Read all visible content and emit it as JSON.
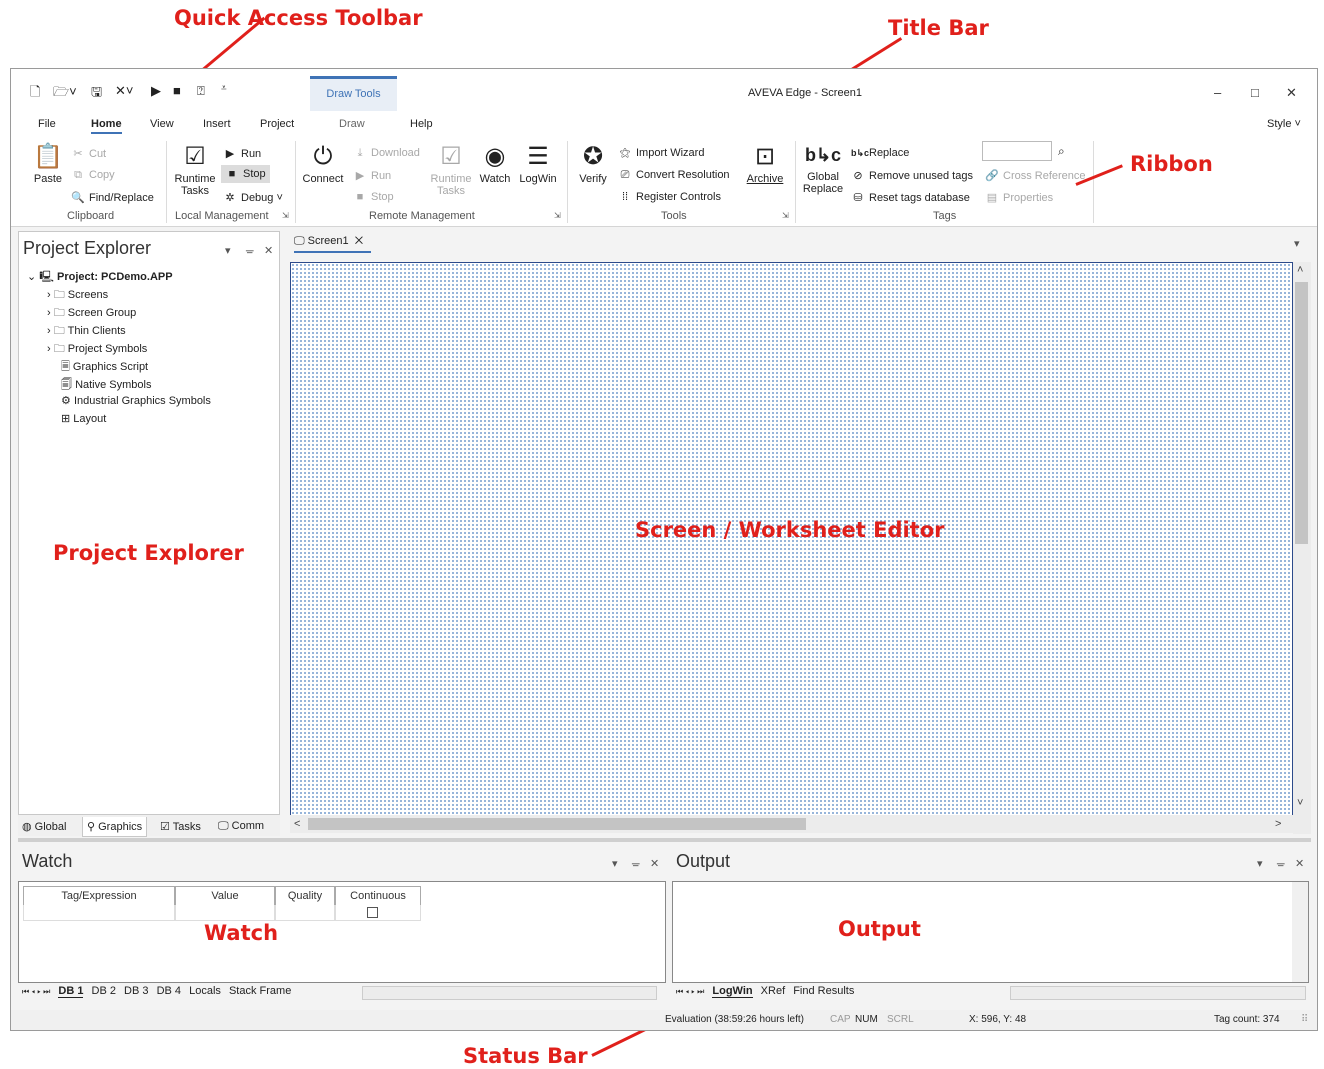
{
  "annotations": {
    "quick_access": "Quick Access Toolbar",
    "title_bar": "Title Bar",
    "ribbon": "Ribbon",
    "project_explorer": "Project Explorer",
    "editor": "Screen / Worksheet Editor",
    "watch": "Watch",
    "output": "Output",
    "status_bar": "Status Bar"
  },
  "titlebar": {
    "draw_tools": "Draw Tools",
    "title": "AVEVA Edge - Screen1",
    "min": "–",
    "max": "□",
    "close": "✕"
  },
  "quick_access": {
    "new": "🗋",
    "open": "🗁˅",
    "save": "🖫",
    "close": "✕˅",
    "run": "▶",
    "stop": "■",
    "help": "⍰",
    "more": "⩡"
  },
  "tabs": [
    "File",
    "Home",
    "View",
    "Insert",
    "Project",
    "Draw",
    "Help"
  ],
  "style_label": "Style",
  "style_chevron": "˅",
  "ribbon": {
    "paste": "Paste",
    "cut": "Cut",
    "copy": "Copy",
    "find_replace": "Find/Replace",
    "runtime_tasks": "Runtime Tasks",
    "run": "Run",
    "stop": "Stop",
    "debug": "Debug",
    "connect": "Connect",
    "download": "Download",
    "remote_run": "Run",
    "remote_stop": "Stop",
    "remote_runtime_tasks": "Runtime Tasks",
    "watch": "Watch",
    "logwin": "LogWin",
    "verify": "Verify",
    "import_wizard": "Import Wizard",
    "convert_resolution": "Convert Resolution",
    "register_controls": "Register Controls",
    "archive": "Archive",
    "global_replace": "Global Replace",
    "replace": "Replace",
    "remove_unused_tags": "Remove unused tags",
    "reset_tags_database": "Reset tags database",
    "cross_reference": "Cross Reference",
    "properties": "Properties",
    "groups": {
      "clipboard": "Clipboard",
      "local_management": "Local Management",
      "remote_management": "Remote Management",
      "tools": "Tools",
      "tags": "Tags"
    }
  },
  "project_explorer": {
    "title": "Project Explorer",
    "project": "Project: PCDemo.APP",
    "items": [
      "Screens",
      "Screen Group",
      "Thin Clients",
      "Project Symbols",
      "Graphics Script",
      "Native Symbols",
      "Industrial Graphics Symbols",
      "Layout"
    ],
    "tabs": [
      "Global",
      "Graphics",
      "Tasks",
      "Comm"
    ]
  },
  "panel_controls": {
    "dropdown": "▾",
    "pin": "ᚚ",
    "close": "✕"
  },
  "editor": {
    "tab": "Screen1",
    "tab_close": "✕",
    "tab_menu": "▾"
  },
  "scroll": {
    "up": "˄",
    "down": "˅",
    "left": "<",
    "right": ">"
  },
  "watch": {
    "title": "Watch",
    "columns": [
      "Tag/Expression",
      "Value",
      "Quality",
      "Continuous"
    ],
    "tabs": [
      "DB 1",
      "DB 2",
      "DB 3",
      "DB 4",
      "Locals",
      "Stack Frame"
    ],
    "nav": "⏮ ◂ ▸ ⏭"
  },
  "output": {
    "title": "Output",
    "tabs": [
      "LogWin",
      "XRef",
      "Find Results"
    ],
    "nav": "⏮ ◂ ▸ ⏭"
  },
  "status_bar": {
    "evaluation": "Evaluation (38:59:26 hours left)",
    "cap": "CAP",
    "num": "NUM",
    "scrl": "SCRL",
    "coords": "X: 596, Y: 48",
    "tag_count": "Tag count: 374",
    "grip": "⠿"
  }
}
